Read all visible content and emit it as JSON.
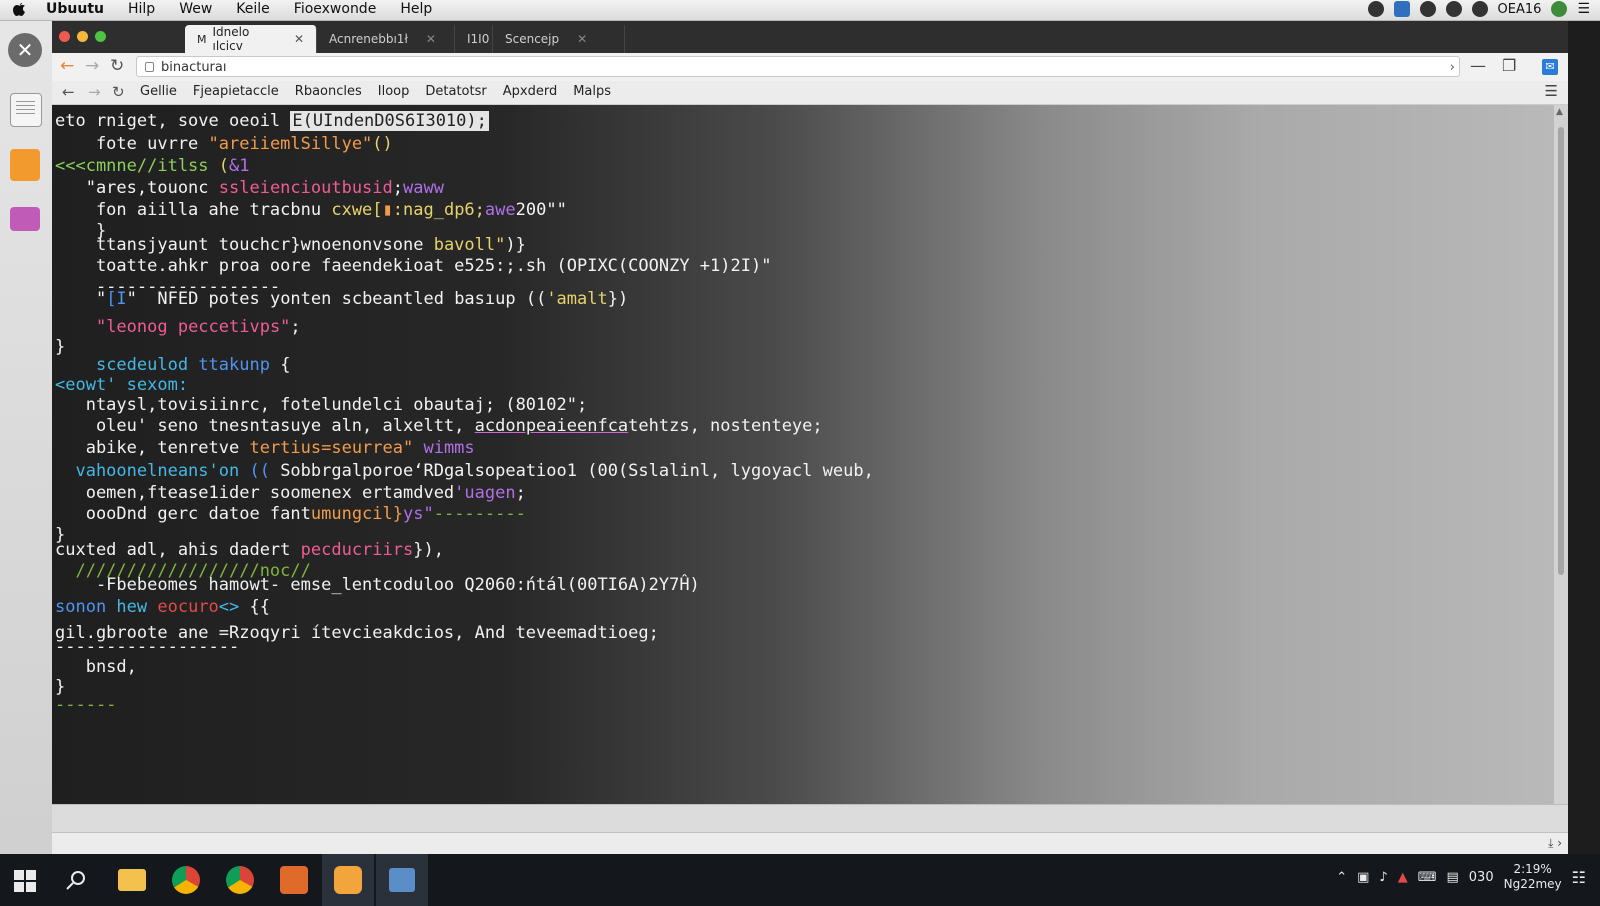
{
  "menubar": {
    "items": [
      "Ubuutu",
      "Hilp",
      "Wew",
      "Keile",
      "Fioexwonde",
      "Help"
    ],
    "clock": "OEA16"
  },
  "window": {
    "tabs": [
      {
        "label": "Idnelo ılcicv",
        "icon": "M"
      },
      {
        "label": "Acnrenebbı1ł",
        "icon": ""
      },
      {
        "label": "I1I0",
        "icon": ""
      },
      {
        "label": "Scencejp",
        "icon": ""
      }
    ],
    "address": "binacturaı",
    "bookmarks": [
      "Gellie",
      "Fjeapietaccle",
      "Rbaoncles",
      "Iloop",
      "Detatotsr",
      "Apxderd",
      "Malps"
    ]
  },
  "code": {
    "lines": [
      {
        "segs": [
          {
            "t": "eto rniget, sove oeoil ",
            "c": "white"
          },
          {
            "t": "E(UIndenD0S6I3010);",
            "c": "boxed"
          }
        ]
      },
      {
        "segs": [
          {
            "t": "    fote uvrre ",
            "c": "white"
          },
          {
            "t": "\"areiiemlSillye\"",
            "c": "orange"
          },
          {
            "t": "()",
            "c": "yellow"
          }
        ]
      },
      {
        "segs": [
          {
            "t": "<<<cmnne//itlss ",
            "c": "green"
          },
          {
            "t": "(",
            "c": "yellow"
          },
          {
            "t": "&1",
            "c": "purple"
          }
        ]
      },
      {
        "segs": [
          {
            "t": "   \"ares,touonc ",
            "c": "white"
          },
          {
            "t": "ssleiencioutbusid",
            "c": "pink"
          },
          {
            "t": ";",
            "c": "white"
          },
          {
            "t": "waww",
            "c": "purple"
          }
        ]
      },
      {
        "segs": [
          {
            "t": "    fon aiilla ahe tracbnu ",
            "c": "white"
          },
          {
            "t": "cxwe[",
            "c": "yellow"
          },
          {
            "t": "▮",
            "c": "orange"
          },
          {
            "t": ":nag_dp6;",
            "c": "yellow"
          },
          {
            "t": "awe",
            "c": "purple"
          },
          {
            "t": "200\"\"",
            "c": "white"
          }
        ]
      },
      {
        "segs": [
          {
            "t": "    }",
            "c": "white"
          }
        ]
      },
      {
        "segs": [
          {
            "t": "    ttansjyaunt touchcr",
            "c": "white"
          },
          {
            "t": "}wnoenonvsone ",
            "c": "white"
          },
          {
            "t": "bavoll\"",
            "c": "yellow"
          },
          {
            "t": ")}",
            "c": "white"
          }
        ]
      },
      {
        "segs": [
          {
            "t": "    toatte.ahkr proa oore faeendekioat e525:;.sh (OPIXC(COONZY +1)2I)\"",
            "c": "white"
          }
        ]
      },
      {
        "segs": [
          {
            "t": "    ------------------",
            "c": "white"
          }
        ]
      },
      {
        "segs": [
          {
            "t": "    \"",
            "c": "white"
          },
          {
            "t": "[I",
            "c": "blue"
          },
          {
            "t": "\"  NFED potes yonten scbeantled basıup ((",
            "c": "white"
          },
          {
            "t": "'amalt",
            "c": "yellow"
          },
          {
            "t": "})",
            "c": "white"
          }
        ]
      },
      {
        "segs": [
          {
            "t": "    ",
            "c": "white"
          },
          {
            "t": "\"leonog peccetivps\"",
            "c": "pink"
          },
          {
            "t": ";",
            "c": "white"
          }
        ]
      },
      {
        "segs": [
          {
            "t": "}",
            "c": "white"
          }
        ]
      },
      {
        "segs": [
          {
            "t": "    ",
            "c": "white"
          },
          {
            "t": "scedeulod ",
            "c": "cyan"
          },
          {
            "t": "ttakunp ",
            "c": "blue"
          },
          {
            "t": "{",
            "c": "white"
          }
        ]
      },
      {
        "segs": [
          {
            "t": "<eowt' sexom:",
            "c": "cyan"
          }
        ]
      },
      {
        "segs": [
          {
            "t": "   ntaysl,tovisiinrc, fotelundelci obautaj; (80102\";",
            "c": "white"
          }
        ]
      },
      {
        "segs": [
          {
            "t": "    oleu' seno tnesntasuye aln, alxeltt, ",
            "c": "white"
          },
          {
            "t": "acdonpeaieenfca",
            "c": "uline"
          },
          {
            "t": "tehtzs, nostenteye;",
            "c": "white"
          }
        ]
      },
      {
        "segs": [
          {
            "t": "   abike, tenretve ",
            "c": "white"
          },
          {
            "t": "tertius=seurrea\"",
            "c": "orange"
          },
          {
            "t": " wimms",
            "c": "purple"
          }
        ]
      },
      {
        "segs": [
          {
            "t": "  vahoonelneans'on ",
            "c": "cyan"
          },
          {
            "t": "((",
            "c": "blue"
          },
          {
            "t": " SobbrgalporoeʻRDgalsopeatioo1 (00(Sslalinl, lygoyacl weub,",
            "c": "white"
          }
        ]
      },
      {
        "segs": [
          {
            "t": "   oemen,ftease1ider soomenex ertamdved",
            "c": "white"
          },
          {
            "t": "'uagen",
            "c": "purple"
          },
          {
            "t": ";",
            "c": "white"
          }
        ]
      },
      {
        "segs": [
          {
            "t": "   oooDnd gerc datoe fant",
            "c": "white"
          },
          {
            "t": "umungcil}",
            "c": "orange"
          },
          {
            "t": "ys\"",
            "c": "purple"
          },
          {
            "t": "---------",
            "c": "lime"
          }
        ]
      },
      {
        "segs": [
          {
            "t": "}",
            "c": "white"
          }
        ]
      },
      {
        "segs": [
          {
            "t": "cuxted adl, ahis dadert ",
            "c": "white"
          },
          {
            "t": "pecducriirs",
            "c": "pink"
          },
          {
            "t": "}),",
            "c": "white"
          }
        ]
      },
      {
        "segs": [
          {
            "t": "  //////////////////noc//",
            "c": "lime"
          }
        ]
      },
      {
        "segs": [
          {
            "t": "    -Fbebeomes hamowt- emse_lentcoduloo Q2060:ńtál(00TI6A)2Y7Ĥ)",
            "c": "white"
          }
        ]
      },
      {
        "segs": [
          {
            "t": "sonon ",
            "c": "blue"
          },
          {
            "t": "hew ",
            "c": "cyan"
          },
          {
            "t": "eocuro",
            "c": "red"
          },
          {
            "t": "<>",
            "c": "cyan"
          },
          {
            "t": " {{",
            "c": "white"
          }
        ]
      },
      {
        "segs": [
          {
            "t": "gil.gbroote ane =Rzoqyri ítevcieakdcios, And teveemadtioeg;",
            "c": "white"
          }
        ]
      },
      {
        "segs": [
          {
            "t": "------------------",
            "c": "white"
          }
        ]
      },
      {
        "segs": [
          {
            "t": "   bnsd,",
            "c": "white"
          }
        ]
      },
      {
        "segs": [
          {
            "t": "}",
            "c": "white"
          }
        ]
      },
      {
        "segs": [
          {
            "t": "------",
            "c": "lime"
          }
        ]
      }
    ]
  },
  "taskbar": {
    "clock_time": "2:19%",
    "clock_date": "Ng22mey",
    "tray_text": "030"
  },
  "colors": {
    "code_bg": "#1f1f1f",
    "accent": "#2c7bd6"
  }
}
